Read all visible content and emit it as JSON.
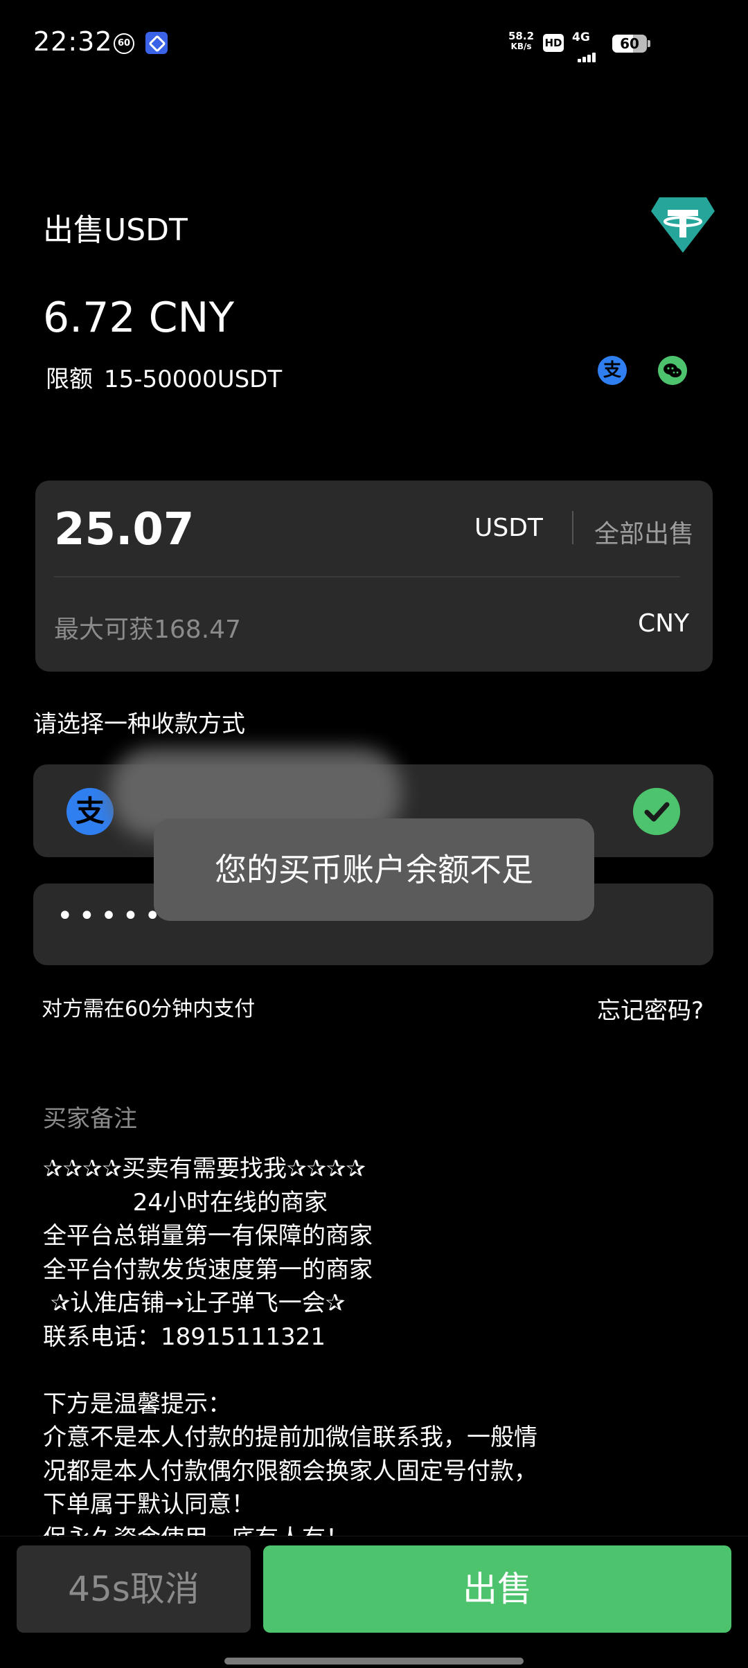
{
  "status_bar": {
    "time": "22:32",
    "notif_badge": "60",
    "net_speed_value": "58.2",
    "net_speed_unit": "KB/s",
    "hd": "HD",
    "network": "4G",
    "battery": "60",
    "battery_level": 0.6
  },
  "header": {
    "title": "出售USDT",
    "price": "6.72 CNY",
    "limit_label": "限额",
    "limit_value": "15-50000USDT",
    "payment_icons": [
      "alipay-icon",
      "wechat-icon"
    ],
    "alipay_glyph": "支",
    "accent_color": "#4dc36e",
    "alipay_color": "#2f7ff1"
  },
  "amount": {
    "value": "25.07",
    "unit": "USDT",
    "sell_all": "全部出售",
    "max_receive": "最大可获168.47",
    "receive_unit": "CNY"
  },
  "payment": {
    "select_label": "请选择一种收款方式",
    "method_glyph": "支"
  },
  "password": {
    "masked": "•••••••••••••••"
  },
  "toast": "您的买币账户余额不足",
  "pay_within": "对方需在60分钟内支付",
  "forgot_password": "忘记密码?",
  "notes": {
    "title": "买家备注",
    "lines": [
      "✰✰✰✰买卖有需要找我✰✰✰✰",
      "            24小时在线的商家",
      "全平台总销量第一有保障的商家",
      "全平台付款发货速度第一的商家",
      " ✰认准店铺→让子弹飞一会✰",
      "联系电话：18915111321",
      "",
      "下方是温馨提示：",
      "介意不是本人付款的提前加微信联系我，一般情",
      "况都是本人付款偶尔限额会换家人固定号付款，",
      "下单属于默认同意！",
      "保永久资金使用，底有人有！"
    ]
  },
  "actions": {
    "cancel": "45s取消",
    "sell": "出售"
  }
}
